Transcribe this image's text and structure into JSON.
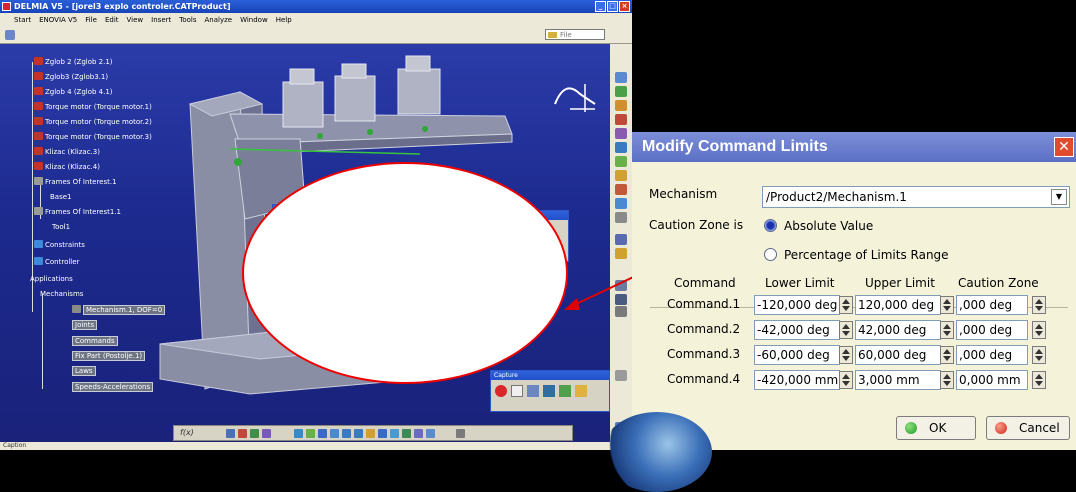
{
  "window": {
    "title": "DELMIA V5 - [jorel3 explo controler.CATProduct]",
    "menu": [
      "Start",
      "ENOVIA V5",
      "File",
      "Edit",
      "View",
      "Insert",
      "Tools",
      "Analyze",
      "Window",
      "Help"
    ],
    "file_box": "File",
    "status": "Caption"
  },
  "tree": {
    "items": [
      "Zglob 2 (Zglob 2.1)",
      "Zglob3 (Zglob3.1)",
      "Zglob 4 (Zglob 4.1)",
      "Torque motor (Torque motor.1)",
      "Torque motor (Torque motor.2)",
      "Torque motor (Torque motor.3)",
      "Klizac (Klizac.3)",
      "Klizac (Klizac.4)",
      "Frames Of Interest.1",
      "Base1",
      "Frames Of Interest1.1",
      "Tool1",
      "Constraints",
      "Controller",
      "Applications",
      "Mechanisms",
      "Mechanism.1, DOF=0",
      "Joints",
      "Commands",
      "Fix Part (Postolje.1)",
      "Laws",
      "Speeds-Accelerations"
    ]
  },
  "capture_palette": {
    "title": "Capture"
  },
  "dialog": {
    "title": "Modify Command Limits",
    "mechanism_label": "Mechanism",
    "mechanism_value": "/Product2/Mechanism.1",
    "caution_label": "Caution Zone is",
    "option_absolute": "Absolute Value",
    "option_percentage": "Percentage of Limits Range",
    "selected_option": "Absolute Value",
    "columns": [
      "Command",
      "Lower Limit",
      "Upper Limit",
      "Caution Zone"
    ],
    "rows": [
      {
        "command": "Command.1",
        "lower": "-120,000 deg",
        "upper": "120,000 deg",
        "caution": ",000 deg"
      },
      {
        "command": "Command.2",
        "lower": "-42,000 deg",
        "upper": "42,000 deg",
        "caution": ",000 deg"
      },
      {
        "command": "Command.3",
        "lower": "-60,000 deg",
        "upper": "60,000 deg",
        "caution": ",000 deg"
      },
      {
        "command": "Command.4",
        "lower": "-420,000 mm",
        "upper": "3,000 mm",
        "caution": "0,000 mm"
      }
    ],
    "ok_label": "OK",
    "cancel_label": "Cancel"
  },
  "colors": {
    "viewport": "#1c2a8e",
    "dialog_title": "#6b7fd0",
    "dialog_bg": "#f5f2da",
    "highlight": "#e00000"
  }
}
